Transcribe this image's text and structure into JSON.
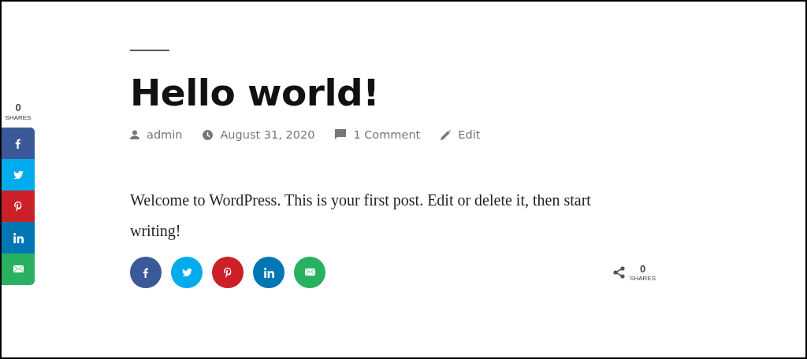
{
  "floating_share": {
    "count": "0",
    "label": "SHARES",
    "networks": [
      {
        "kind": "facebook",
        "color": "#3b5998"
      },
      {
        "kind": "twitter",
        "color": "#00aced"
      },
      {
        "kind": "pinterest",
        "color": "#cb2027"
      },
      {
        "kind": "linkedin",
        "color": "#0077b5"
      },
      {
        "kind": "email",
        "color": "#29b061"
      }
    ]
  },
  "post": {
    "title": "Hello world!",
    "meta": [
      {
        "kind": "author",
        "text": "admin"
      },
      {
        "kind": "date",
        "text": "August 31, 2020"
      },
      {
        "kind": "comments",
        "text": "1 Comment"
      },
      {
        "kind": "edit",
        "text": "Edit"
      }
    ],
    "body": "Welcome to WordPress. This is your first post. Edit or delete it, then start writing!"
  },
  "share_bar": {
    "networks": [
      {
        "kind": "facebook",
        "color": "#3b5998"
      },
      {
        "kind": "twitter",
        "color": "#00aced"
      },
      {
        "kind": "pinterest",
        "color": "#cb2027"
      },
      {
        "kind": "linkedin",
        "color": "#0077b5"
      },
      {
        "kind": "email",
        "color": "#29b061"
      }
    ],
    "count": "0",
    "label": "SHARES"
  }
}
